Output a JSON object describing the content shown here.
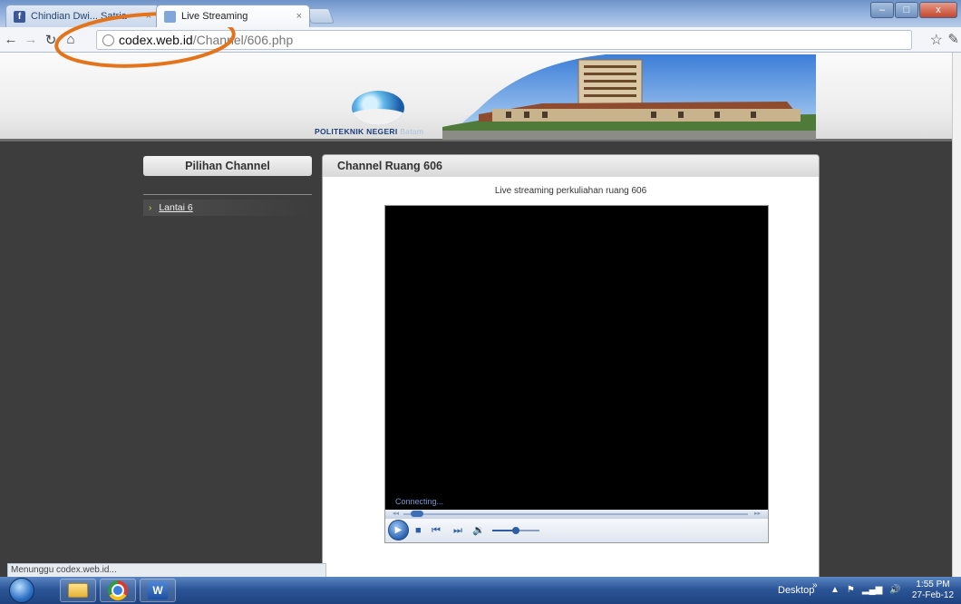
{
  "browser": {
    "tabs": [
      {
        "label": "Chindian Dwi... Satria",
        "favicon": "facebook-icon",
        "active": false
      },
      {
        "label": "Live Streaming",
        "favicon": "page-icon",
        "active": true
      }
    ],
    "close_glyph": "×",
    "window_buttons": {
      "minimize": "–",
      "maximize": "□",
      "close": "x"
    },
    "url": {
      "host": "codex.web.id",
      "path": "/Channel/606.php"
    }
  },
  "page": {
    "logo": {
      "name": "POLITEKNIK NEGERI",
      "sub": "Batam"
    },
    "sidebar": {
      "title": "Pilihan Channel",
      "items": [
        {
          "label": "Lantai 6"
        }
      ]
    },
    "content": {
      "title": "Channel Ruang 606",
      "subtitle": "Live streaming perkuliahan ruang 606"
    },
    "player": {
      "status": "Connecting...",
      "seek_fraction": 0.02,
      "volume_fraction": 0.5
    }
  },
  "statusbar": {
    "text": "Menunggu codex.web.id..."
  },
  "taskbar": {
    "desktop_label": "Desktop",
    "more": "»",
    "tray_icons": [
      "up-arrow-icon",
      "flag-icon",
      "signal-icon",
      "volume-icon"
    ],
    "clock": {
      "time": "1:55 PM",
      "date": "27-Feb-12"
    }
  },
  "colors": {
    "page_bg": "#3d3d3d",
    "accent_blue": "#2f5da3",
    "annotation_orange": "#e4741c"
  }
}
